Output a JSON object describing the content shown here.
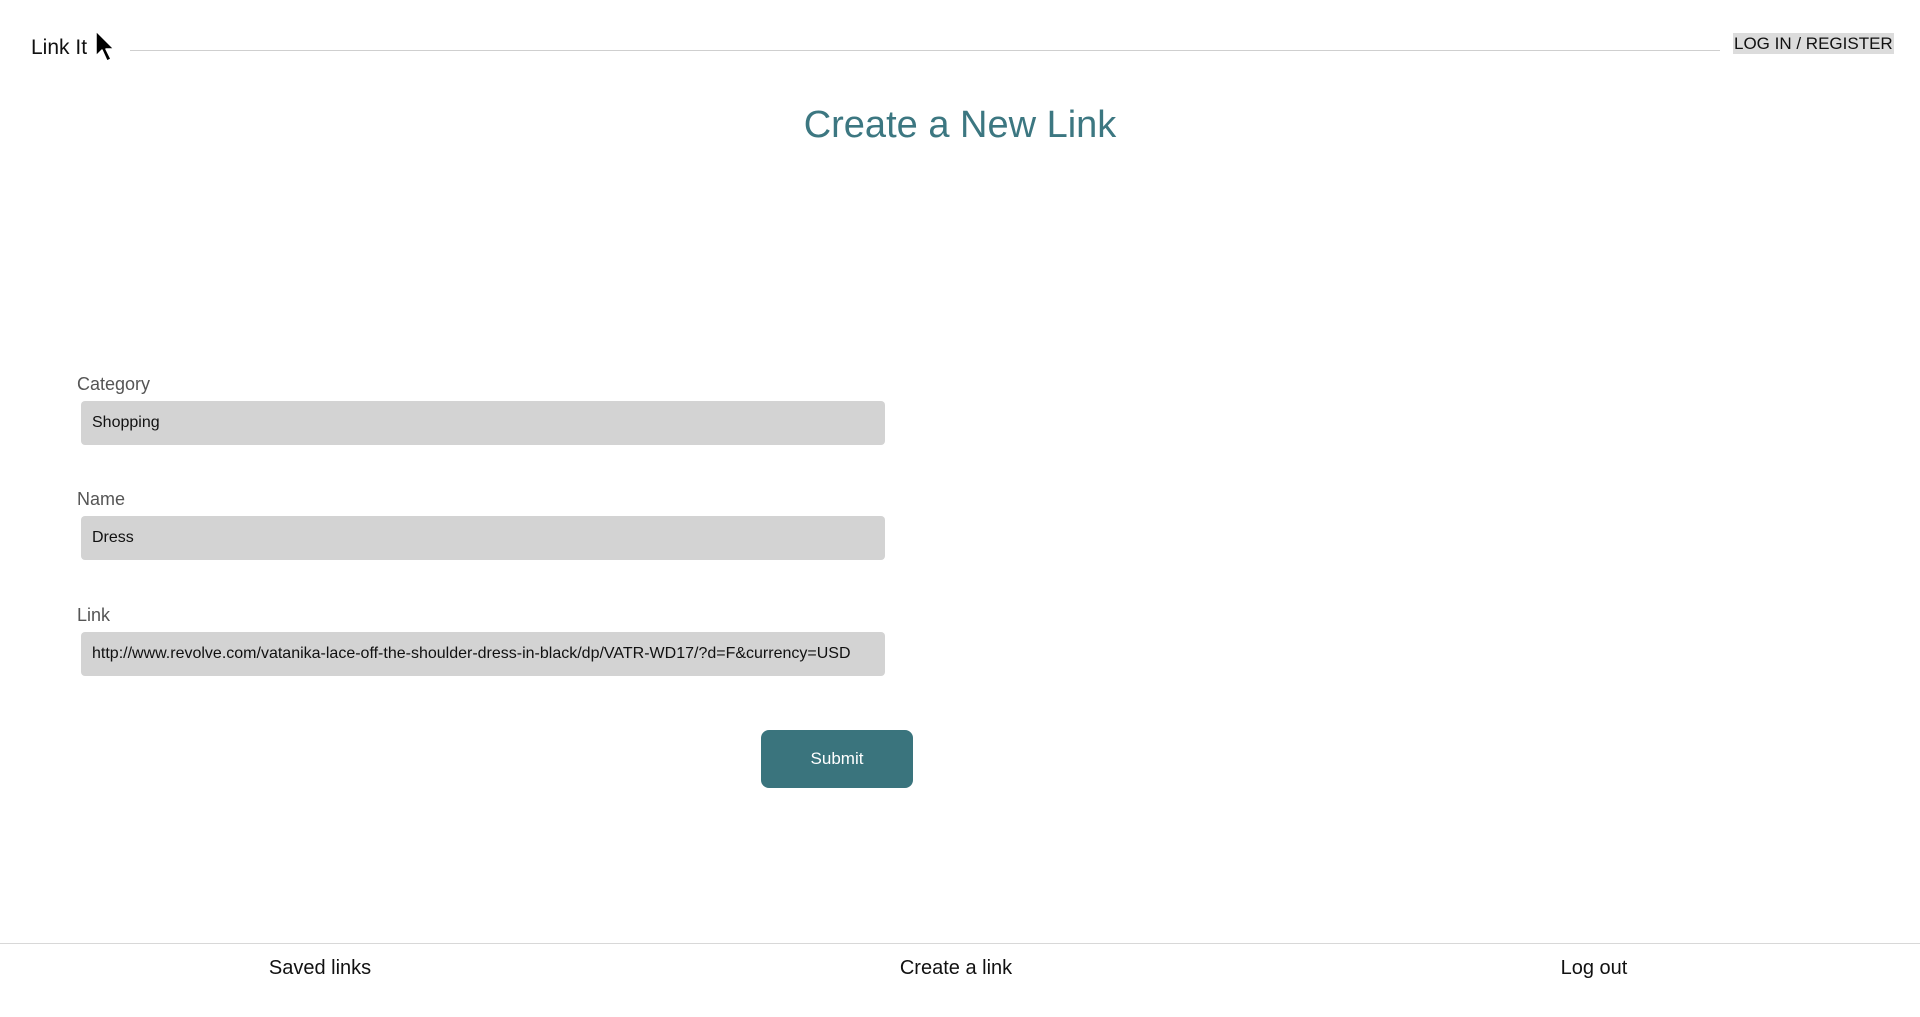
{
  "header": {
    "brand": "Link It",
    "login_label": "LOG IN / REGISTER"
  },
  "main": {
    "title": "Create a New Link"
  },
  "form": {
    "category": {
      "label": "Category",
      "value": "Shopping"
    },
    "name": {
      "label": "Name",
      "value": "Dress"
    },
    "link": {
      "label": "Link",
      "value": "http://www.revolve.com/vatanika-lace-off-the-shoulder-dress-in-black/dp/VATR-WD17/?d=F&currency=USD"
    },
    "submit_label": "Submit"
  },
  "footer": {
    "items": [
      {
        "label": "Saved links"
      },
      {
        "label": "Create a link"
      },
      {
        "label": "Log out"
      }
    ]
  },
  "colors": {
    "accent": "#3a747d",
    "title": "#3c7781",
    "input_background": "#d3d3d3"
  },
  "icons": {
    "pointer": "mouse-pointer-icon"
  }
}
